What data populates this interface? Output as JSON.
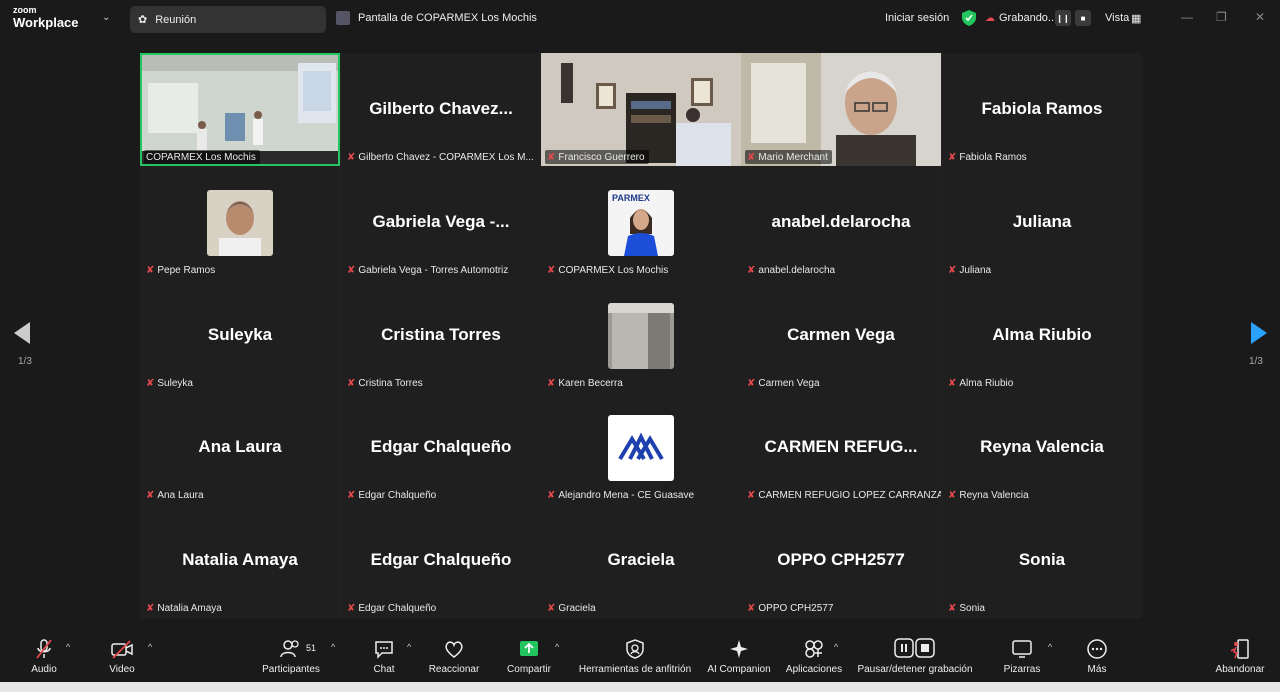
{
  "app": {
    "brand_small": "zoom",
    "brand_big": "Workplace"
  },
  "topbar": {
    "meeting_label": "Reunión",
    "share_title": "Pantalla de COPARMEX Los Mochis",
    "signin": "Iniciar sesión",
    "recording": "Grabando...",
    "view": "Vista"
  },
  "pager": {
    "left": "1/3",
    "right": "1/3"
  },
  "tiles": [
    {
      "name": "",
      "label": "COPARMEX Los Mochis",
      "type": "video1"
    },
    {
      "name": "Gilberto  Chavez...",
      "label": "Gilberto Chavez - COPARMEX Los M..."
    },
    {
      "name": "",
      "label": "Francisco Guerrero",
      "type": "video2"
    },
    {
      "name": "",
      "label": "Mario Merchant",
      "type": "video3"
    },
    {
      "name": "Fabiola Ramos",
      "label": "Fabiola Ramos"
    },
    {
      "name": "",
      "label": "Pepe Ramos",
      "type": "avatar-man"
    },
    {
      "name": "Gabriela  Vega  -...",
      "label": "Gabriela Vega - Torres Automotriz"
    },
    {
      "name": "",
      "label": "COPARMEX Los Mochis",
      "type": "avatar-woman"
    },
    {
      "name": "anabel.delarocha",
      "label": "anabel.delarocha"
    },
    {
      "name": "Juliana",
      "label": "Juliana"
    },
    {
      "name": "Suleyka",
      "label": "Suleyka"
    },
    {
      "name": "Cristina Torres",
      "label": "Cristina Torres"
    },
    {
      "name": "",
      "label": "Karen Becerra",
      "type": "avatar-gray"
    },
    {
      "name": "Carmen Vega",
      "label": "Carmen Vega"
    },
    {
      "name": "Alma Riubio",
      "label": "Alma Riubio"
    },
    {
      "name": "Ana Laura",
      "label": "Ana Laura"
    },
    {
      "name": "Edgar Chalqueño",
      "label": "Edgar Chalqueño"
    },
    {
      "name": "",
      "label": "Alejandro Mena - CE Guasave",
      "type": "avatar-logo"
    },
    {
      "name": "CARMEN  REFUG...",
      "label": "CARMEN REFUGIO LOPEZ CARRANZA"
    },
    {
      "name": "Reyna Valencia",
      "label": "Reyna Valencia"
    },
    {
      "name": "Natalia Amaya",
      "label": "Natalia Amaya"
    },
    {
      "name": "Edgar Chalqueño",
      "label": "Edgar Chalqueño"
    },
    {
      "name": "Graciela",
      "label": "Graciela"
    },
    {
      "name": "OPPO CPH2577",
      "label": "OPPO CPH2577"
    },
    {
      "name": "Sonia",
      "label": "Sonia"
    }
  ],
  "toolbar": {
    "audio": "Audio",
    "video": "Video",
    "participants": "Participantes",
    "participants_count": "51",
    "chat": "Chat",
    "react": "Reaccionar",
    "share": "Compartir",
    "host_tools": "Herramientas de anfitrión",
    "ai": "AI Companion",
    "apps": "Aplicaciones",
    "pause_rec": "Pausar/detener grabación",
    "whiteboards": "Pizarras",
    "more": "Más",
    "leave": "Abandonar"
  },
  "colors": {
    "active_border": "#22c55e",
    "share_green": "#22c55e",
    "nav_active": "#2aa3ff",
    "muted_red": "#e5484d"
  }
}
